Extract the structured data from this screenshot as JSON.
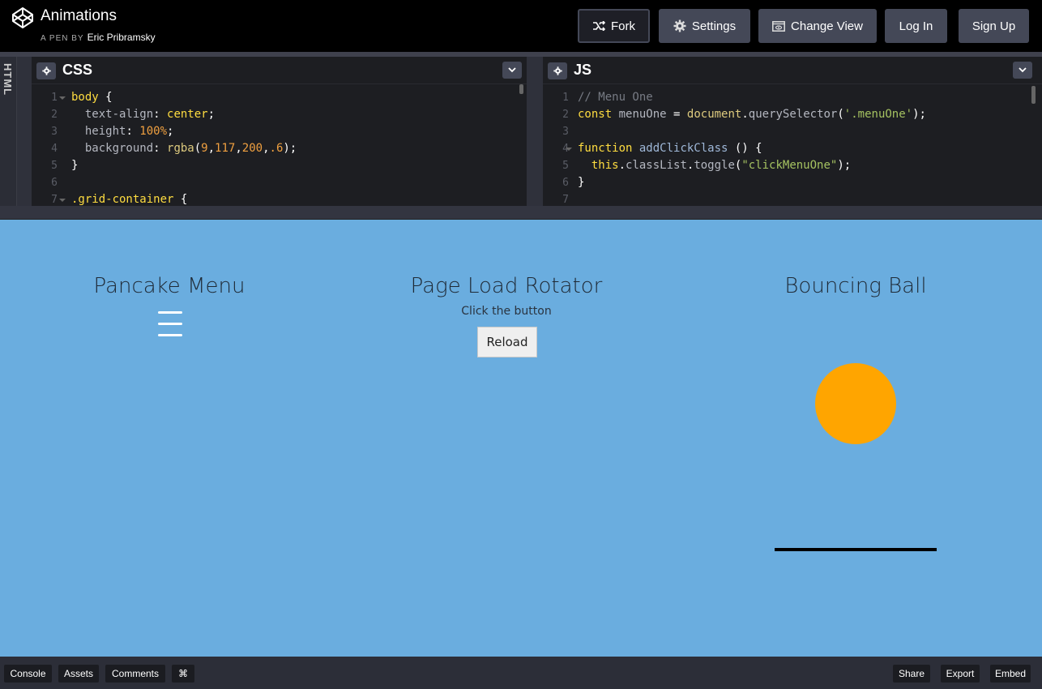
{
  "header": {
    "title": "Animations",
    "by_label": "A PEN BY",
    "author": "Eric Pribramsky",
    "buttons": {
      "fork": "Fork",
      "settings": "Settings",
      "change_view": "Change View",
      "login": "Log In",
      "signup": "Sign Up"
    }
  },
  "editors": {
    "html_label": "HTML",
    "css": {
      "title": "CSS",
      "line_numbers": [
        "1",
        "2",
        "3",
        "4",
        "5",
        "6",
        "7"
      ]
    },
    "js": {
      "title": "JS",
      "line_numbers": [
        "1",
        "2",
        "3",
        "4",
        "5",
        "6",
        "7"
      ]
    }
  },
  "preview": {
    "pancake_title": "Pancake Menu",
    "rotator_title": "Page Load Rotator",
    "rotator_sub": "Click the button",
    "reload_label": "Reload",
    "ball_title": "Bouncing Ball",
    "background": "#6aaddf",
    "ball_color": "#ffa500"
  },
  "bottom_bar": {
    "console": "Console",
    "assets": "Assets",
    "comments": "Comments",
    "shortcut": "⌘",
    "share": "Share",
    "export": "Export",
    "embed": "Embed"
  },
  "icons": [
    "codepen-logo-icon",
    "fork-icon",
    "gear-icon",
    "change-view-icon",
    "chevron-down-icon"
  ]
}
